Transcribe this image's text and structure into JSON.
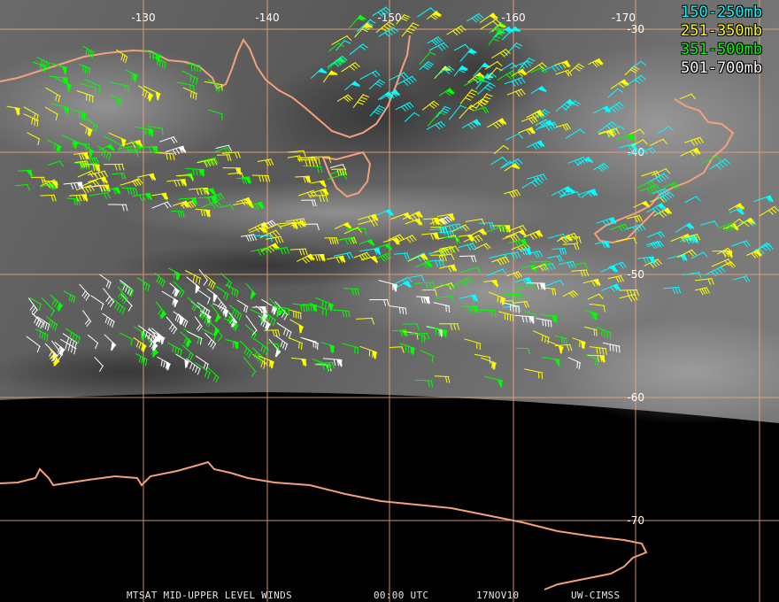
{
  "map": {
    "lon_labels": [
      "-130",
      "-140",
      "-150",
      "-160",
      "-170"
    ],
    "lat_labels": [
      "-30",
      "-40",
      "-50",
      "-60",
      "-70"
    ]
  },
  "legend": {
    "items": [
      {
        "label": "150-250mb",
        "color": "#00ffff"
      },
      {
        "label": "251-350mb",
        "color": "#ffff00"
      },
      {
        "label": "351-500mb",
        "color": "#00ff00"
      },
      {
        "label": "501-700mb",
        "color": "#ffffff"
      }
    ]
  },
  "footer": {
    "product": "MTSAT MID-UPPER LEVEL WINDS",
    "time": "00:00 UTC",
    "date": "17NOV10",
    "source": "UW-CIMSS"
  },
  "colors": {
    "coastline": "#f4a07c",
    "gridline": "#f2a57a",
    "barb_cyan": "#00ffff",
    "barb_yellow": "#ffff00",
    "barb_green": "#00ff00",
    "barb_white": "#ffffff"
  }
}
